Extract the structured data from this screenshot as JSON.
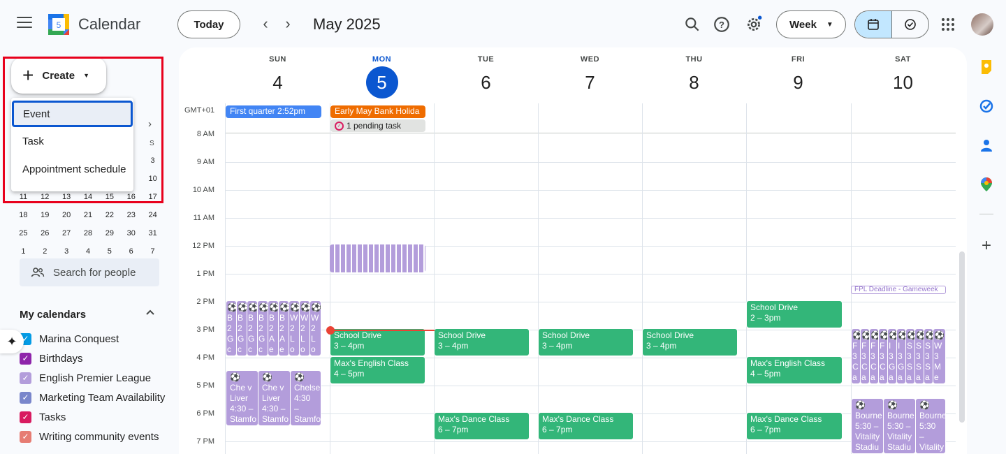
{
  "header": {
    "app_title": "Calendar",
    "logo_day": "5",
    "today_label": "Today",
    "prev_icon": "‹",
    "next_icon": "›",
    "month": "May 2025",
    "view_select": "Week",
    "icons": [
      "search-icon",
      "help-icon",
      "settings-icon",
      "calendar-view-icon",
      "tasks-view-icon",
      "apps-icon",
      "avatar"
    ]
  },
  "sidebar": {
    "create_label": "Create",
    "create_menu": [
      "Event",
      "Task",
      "Appointment schedule"
    ],
    "mini_cal": {
      "top_right": "S",
      "rows": [
        [
          "",
          "",
          "",
          "",
          "",
          "",
          "3"
        ],
        [
          "",
          "",
          "",
          "",
          "",
          "",
          "10"
        ],
        [
          "11",
          "12",
          "13",
          "14",
          "15",
          "16",
          "17"
        ],
        [
          "18",
          "19",
          "20",
          "21",
          "22",
          "23",
          "24"
        ],
        [
          "25",
          "26",
          "27",
          "28",
          "29",
          "30",
          "31"
        ],
        [
          "1",
          "2",
          "3",
          "4",
          "5",
          "6",
          "7"
        ]
      ]
    },
    "search_people": "Search for people",
    "my_calendars_title": "My calendars",
    "calendars": [
      {
        "label": "Marina Conquest",
        "color": "#039be5",
        "checked": true
      },
      {
        "label": "Birthdays",
        "color": "#8e24aa",
        "checked": true
      },
      {
        "label": "English Premier League",
        "color": "#b39ddb",
        "checked": true
      },
      {
        "label": "Marketing Team Availability",
        "color": "#7986cb",
        "checked": true
      },
      {
        "label": "Tasks",
        "color": "#d81b60",
        "checked": true
      },
      {
        "label": "Writing community events",
        "color": "#e67c73",
        "checked": true
      }
    ]
  },
  "week": {
    "timezone": "GMT+01",
    "days": [
      {
        "dow": "SUN",
        "num": "4",
        "today": false
      },
      {
        "dow": "MON",
        "num": "5",
        "today": true
      },
      {
        "dow": "TUE",
        "num": "6",
        "today": false
      },
      {
        "dow": "WED",
        "num": "7",
        "today": false
      },
      {
        "dow": "THU",
        "num": "8",
        "today": false
      },
      {
        "dow": "FRI",
        "num": "9",
        "today": false
      },
      {
        "dow": "SAT",
        "num": "10",
        "today": false
      }
    ],
    "hours": [
      "8 AM",
      "9 AM",
      "10 AM",
      "11 AM",
      "12 PM",
      "1 PM",
      "2 PM",
      "3 PM",
      "4 PM",
      "5 PM",
      "6 PM",
      "7 PM"
    ],
    "all_day": {
      "sun": "First quarter 2:52pm",
      "mon_holiday": "Early May Bank Holida",
      "mon_task": "1 pending task"
    },
    "events": {
      "school_drive": "School Drive",
      "school_drive_time": "3 – 4pm",
      "school_drive_fri_time": "2 – 3pm",
      "english": "Max's English Class",
      "english_time": "4 – 5pm",
      "dance": "Max's Dance Class",
      "dance_time": "6 – 7pm",
      "fpl": "FPL Deadline - Gameweek",
      "sun_evening_1": "⚽ Che v Liver 4:30 – Stamfo Bridge,",
      "sun_evening_2": "⚽ Che v Liver 4:30 – Stamfo Bridge,",
      "sun_evening_3": "⚽ Chelse 4:30 – Stamfo rd",
      "sat_evening": "⚽ Bourne 5:30 – Vitality Stadiu"
    },
    "sun_narrow": [
      "⚽ B 2 G c",
      "⚽ B 2 G c",
      "⚽ B 2 G c",
      "⚽ B 2 G c",
      "⚽ B 2 A e",
      "⚽ B 2 A e",
      "⚽ W 2 L o",
      "⚽ W 2 L o",
      "⚽ W 2 L o"
    ],
    "sat_narrow": [
      "⚽ F 3 C a",
      "⚽ F 3 C a",
      "⚽ F 3 C a",
      "⚽ F 3 C a",
      "⚽ I 3 G a",
      "⚽ I 3 G a",
      "⚽ S 3 S a",
      "⚽ S 3 S a",
      "⚽ S 3 S a",
      "⚽ W 3 M e"
    ]
  }
}
